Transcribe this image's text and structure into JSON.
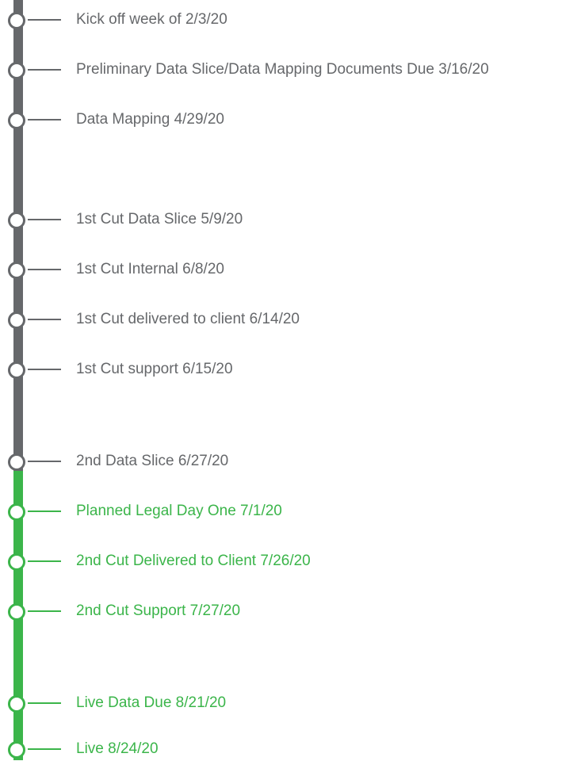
{
  "colors": {
    "done": "#66686b",
    "upcoming": "#3bb54a"
  },
  "milestones": [
    {
      "label": "Kick off week of 2/3/20",
      "status": "done"
    },
    {
      "label": "Preliminary Data Slice/Data Mapping Documents Due 3/16/20",
      "status": "done"
    },
    {
      "label": "Data Mapping 4/29/20",
      "status": "done"
    },
    {
      "label": "1st Cut Data Slice 5/9/20",
      "status": "done"
    },
    {
      "label": "1st Cut Internal 6/8/20",
      "status": "done"
    },
    {
      "label": "1st Cut delivered to client 6/14/20",
      "status": "done"
    },
    {
      "label": "1st Cut support 6/15/20",
      "status": "done"
    },
    {
      "label": "2nd Data Slice 6/27/20",
      "status": "done"
    },
    {
      "label": "Planned Legal Day One 7/1/20",
      "status": "upcoming"
    },
    {
      "label": "2nd Cut Delivered to Client 7/26/20",
      "status": "upcoming"
    },
    {
      "label": "2nd Cut Support 7/27/20",
      "status": "upcoming"
    },
    {
      "label": "Live Data Due 8/21/20",
      "status": "upcoming"
    },
    {
      "label": "Live 8/24/20",
      "status": "upcoming"
    }
  ]
}
